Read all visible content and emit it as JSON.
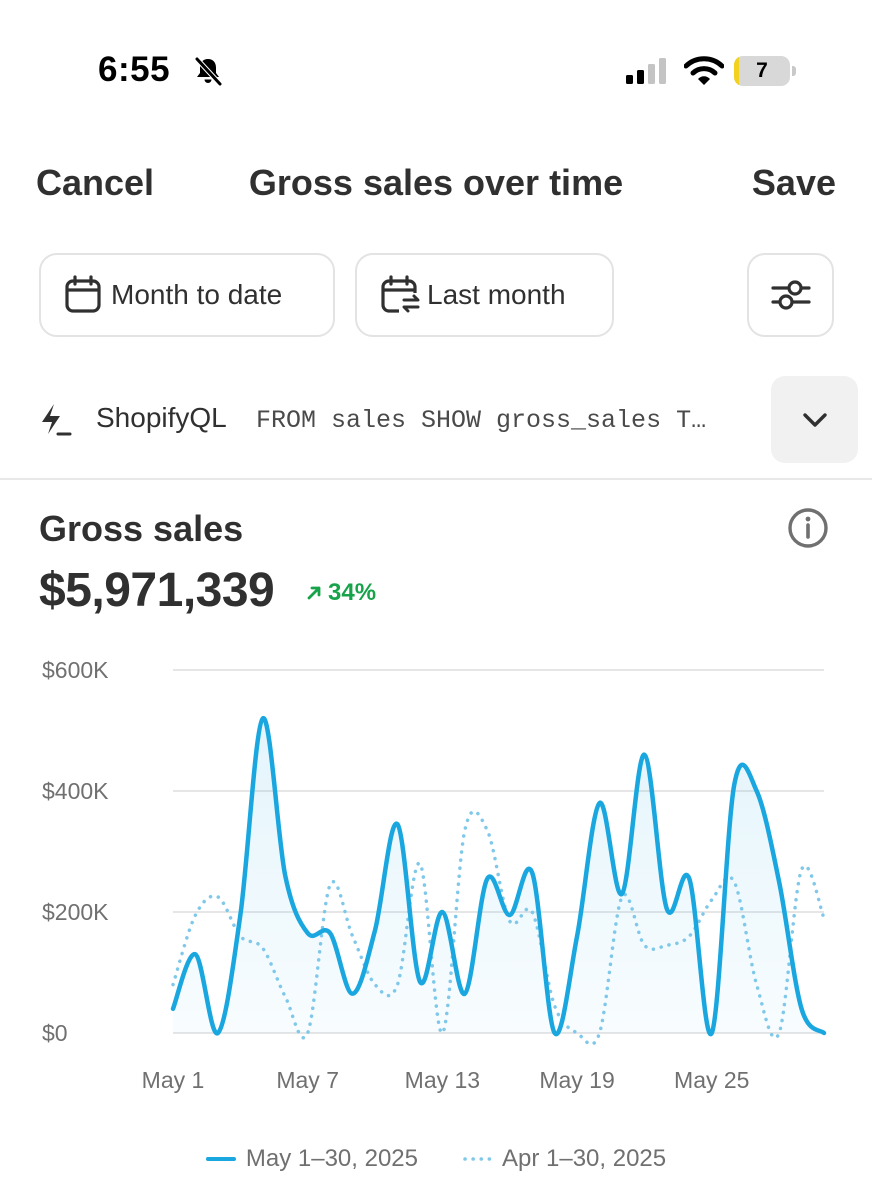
{
  "status_bar": {
    "time": "6:55",
    "battery": "7"
  },
  "header": {
    "cancel_label": "Cancel",
    "title": "Gross sales over time",
    "save_label": "Save"
  },
  "filters": {
    "date_range_label": "Month to date",
    "comparison_label": "Last month"
  },
  "query": {
    "label": "ShopifyQL",
    "text": "FROM sales SHOW gross_sales T…"
  },
  "metric": {
    "title": "Gross sales",
    "value": "$5,971,339",
    "change": "34%"
  },
  "icons": {
    "bell": "bell-slash-icon",
    "signal": "cellular-signal-icon",
    "wifi": "wifi-icon",
    "calendar": "calendar-icon",
    "calendar_compare": "calendar-compare-icon",
    "settings": "sliders-icon",
    "query": "lightning-icon",
    "expand": "chevron-down-icon",
    "info": "info-icon"
  },
  "colors": {
    "current_series": "#1aa7e0",
    "previous_series": "#7fc8ea",
    "positive": "#16a34a"
  },
  "chart_data": {
    "type": "line",
    "y_ticks": [
      "$0",
      "$200K",
      "$400K",
      "$600K"
    ],
    "ylim": [
      0,
      600000
    ],
    "x_tick_labels": [
      "May 1",
      "May 7",
      "May 13",
      "May 19",
      "May 25"
    ],
    "x_tick_days": [
      1,
      7,
      13,
      19,
      25
    ],
    "x": [
      1,
      2,
      3,
      4,
      5,
      6,
      7,
      8,
      9,
      10,
      11,
      12,
      13,
      14,
      15,
      16,
      17,
      18,
      19,
      20,
      21,
      22,
      23,
      24,
      25,
      26,
      27,
      28,
      29,
      30
    ],
    "grid": true,
    "legend_position": "bottom",
    "series": [
      {
        "name": "May 1–30, 2025",
        "style": "solid",
        "values": [
          40000,
          130000,
          0,
          195000,
          520000,
          260000,
          165000,
          165000,
          65000,
          170000,
          345000,
          85000,
          200000,
          65000,
          255000,
          195000,
          265000,
          0,
          160000,
          380000,
          230000,
          460000,
          205000,
          255000,
          0,
          410000,
          400000,
          250000,
          40000,
          0
        ]
      },
      {
        "name": "Apr 1–30, 2025",
        "style": "dotted",
        "values": [
          80000,
          195000,
          225000,
          160000,
          140000,
          60000,
          0,
          245000,
          160000,
          80000,
          80000,
          280000,
          0,
          335000,
          335000,
          185000,
          200000,
          45000,
          0,
          0,
          225000,
          145000,
          145000,
          160000,
          220000,
          250000,
          80000,
          0,
          270000,
          190000
        ]
      }
    ]
  }
}
